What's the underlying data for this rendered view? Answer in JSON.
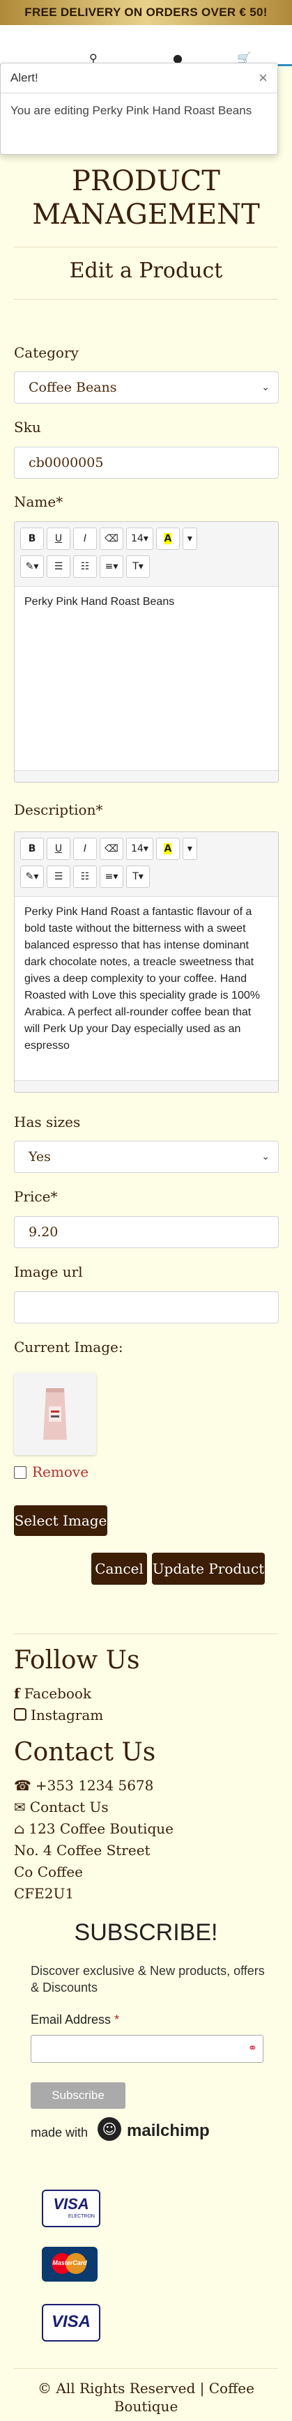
{
  "banner": {
    "text": "FREE DELIVERY ON ORDERS OVER € 50!"
  },
  "alert": {
    "title": "Alert!",
    "close": "×",
    "message": "You are editing Perky Pink Hand Roast Beans"
  },
  "page": {
    "title_line1": "PRODUCT",
    "title_line2": "MANAGEMENT",
    "subtitle": "Edit a Product"
  },
  "form": {
    "category_label": "Category",
    "category_value": "Coffee Beans",
    "sku_label": "Sku",
    "sku_value": "cb0000005",
    "name_label": "Name*",
    "name_value": "Perky Pink Hand Roast Beans",
    "description_label": "Description*",
    "description_value": "Perky Pink Hand Roast a fantastic flavour of a bold taste without the bitterness with a sweet balanced espresso that has intense dominant dark chocolate notes, a treacle sweetness that gives a deep complexity to your coffee. Hand Roasted with Love this speciality grade is 100% Arabica. A perfect all-rounder coffee bean that will Perk Up your Day especially used as an espresso",
    "has_sizes_label": "Has sizes",
    "has_sizes_value": "Yes",
    "price_label": "Price*",
    "price_value": "9.20",
    "image_url_label": "Image url",
    "image_url_value": "",
    "current_image_label": "Current Image:",
    "remove_label": "Remove",
    "select_image_label": "Select Image",
    "cancel_label": "Cancel",
    "update_label": "Update Product"
  },
  "toolbar": {
    "bold": "B",
    "underline": "U",
    "italic": "I",
    "eraser": "⌫",
    "font_size": "14",
    "color": "A",
    "magic": "✎",
    "bullets": "☰",
    "numbers": "☷",
    "align": "≡",
    "text_style": "T"
  },
  "footer": {
    "follow_title": "Follow Us",
    "facebook": "Facebook",
    "instagram": "Instagram",
    "contact_title": "Contact Us",
    "phone": "+353 1234 5678",
    "contact_link": "Contact Us",
    "address_line1": "123 Coffee Boutique",
    "address_line2": "No. 4 Coffee Street",
    "address_line3": "Co Coffee",
    "address_line4": "CFE2U1",
    "subscribe_title": "SUBSCRIBE!",
    "subscribe_text": "Discover exclusive & New products, offers & Discounts",
    "email_label": "Email Address",
    "email_required": "*",
    "subscribe_button": "Subscribe",
    "made_with": "made with",
    "mailchimp": "mailchimp",
    "card1_text": "VISA",
    "card1_sub": "ELECTRON",
    "card2_text": "MasterCard",
    "card3_text": "VISA",
    "copyright_line1": "© All Rights Reserved | Coffee",
    "copyright_line2": "Boutique"
  },
  "colors": {
    "brand_dark": "#3d1e06",
    "background": "#fefee6",
    "accent_blue": "#2c8fbf"
  }
}
